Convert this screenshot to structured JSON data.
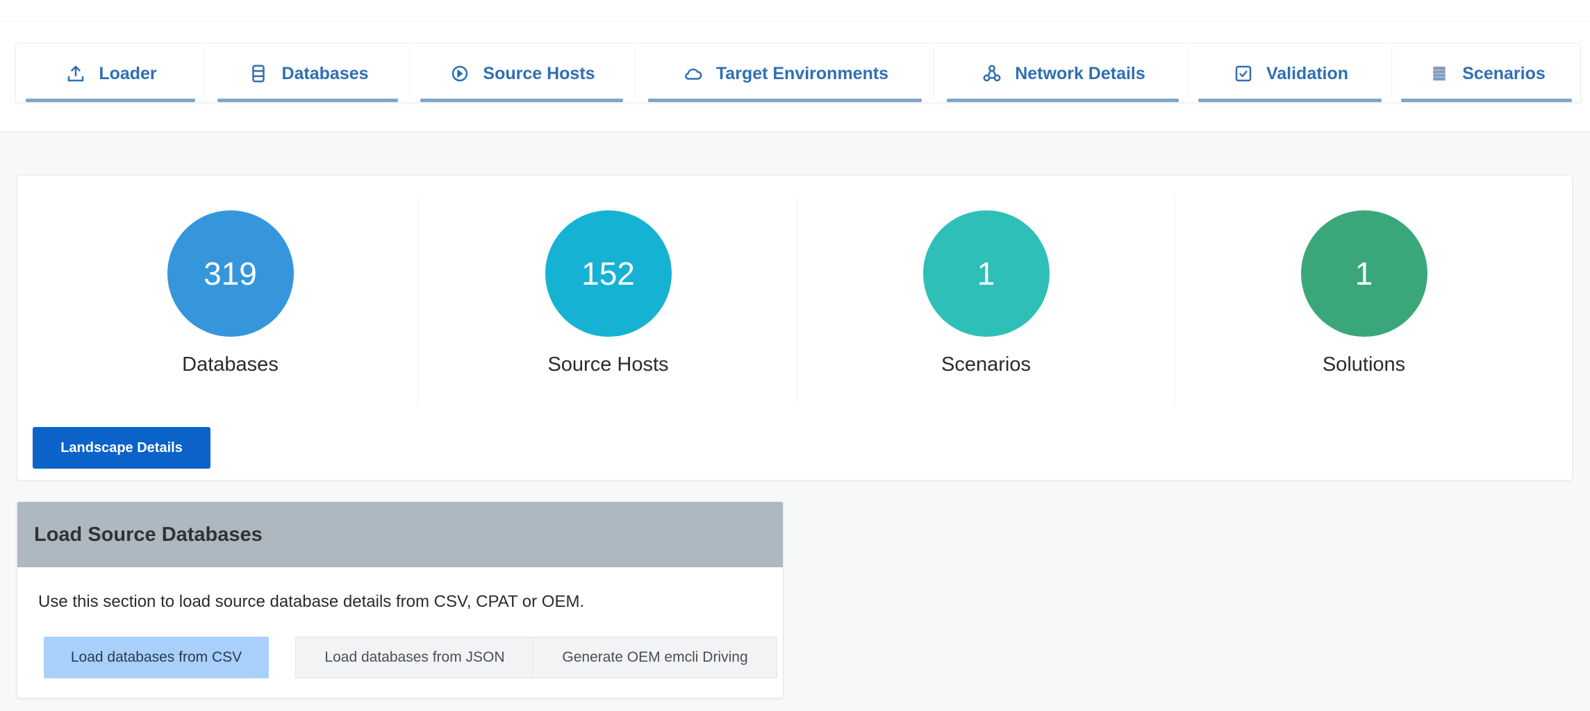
{
  "tabs": [
    {
      "label": "Loader",
      "icon": "upload-icon"
    },
    {
      "label": "Databases",
      "icon": "database-icon"
    },
    {
      "label": "Source Hosts",
      "icon": "server-icon"
    },
    {
      "label": "Target Environments",
      "icon": "cloud-icon"
    },
    {
      "label": "Network Details",
      "icon": "network-icon"
    },
    {
      "label": "Validation",
      "icon": "checkbox-icon"
    },
    {
      "label": "Scenarios",
      "icon": "list-icon"
    }
  ],
  "summary": {
    "stats": [
      {
        "value": "319",
        "label": "Databases",
        "color": "#3596dc"
      },
      {
        "value": "152",
        "label": "Source Hosts",
        "color": "#16b2d3"
      },
      {
        "value": "1",
        "label": "Scenarios",
        "color": "#2ebfb8"
      },
      {
        "value": "1",
        "label": "Solutions",
        "color": "#3aa77a"
      }
    ],
    "landscape_button": "Landscape Details"
  },
  "load_panel": {
    "title": "Load Source Databases",
    "description": "Use this section to load source database details from CSV, CPAT or OEM.",
    "buttons": {
      "csv": "Load databases from CSV",
      "json": "Load databases from JSON",
      "oem": "Generate OEM emcli Driving"
    }
  }
}
